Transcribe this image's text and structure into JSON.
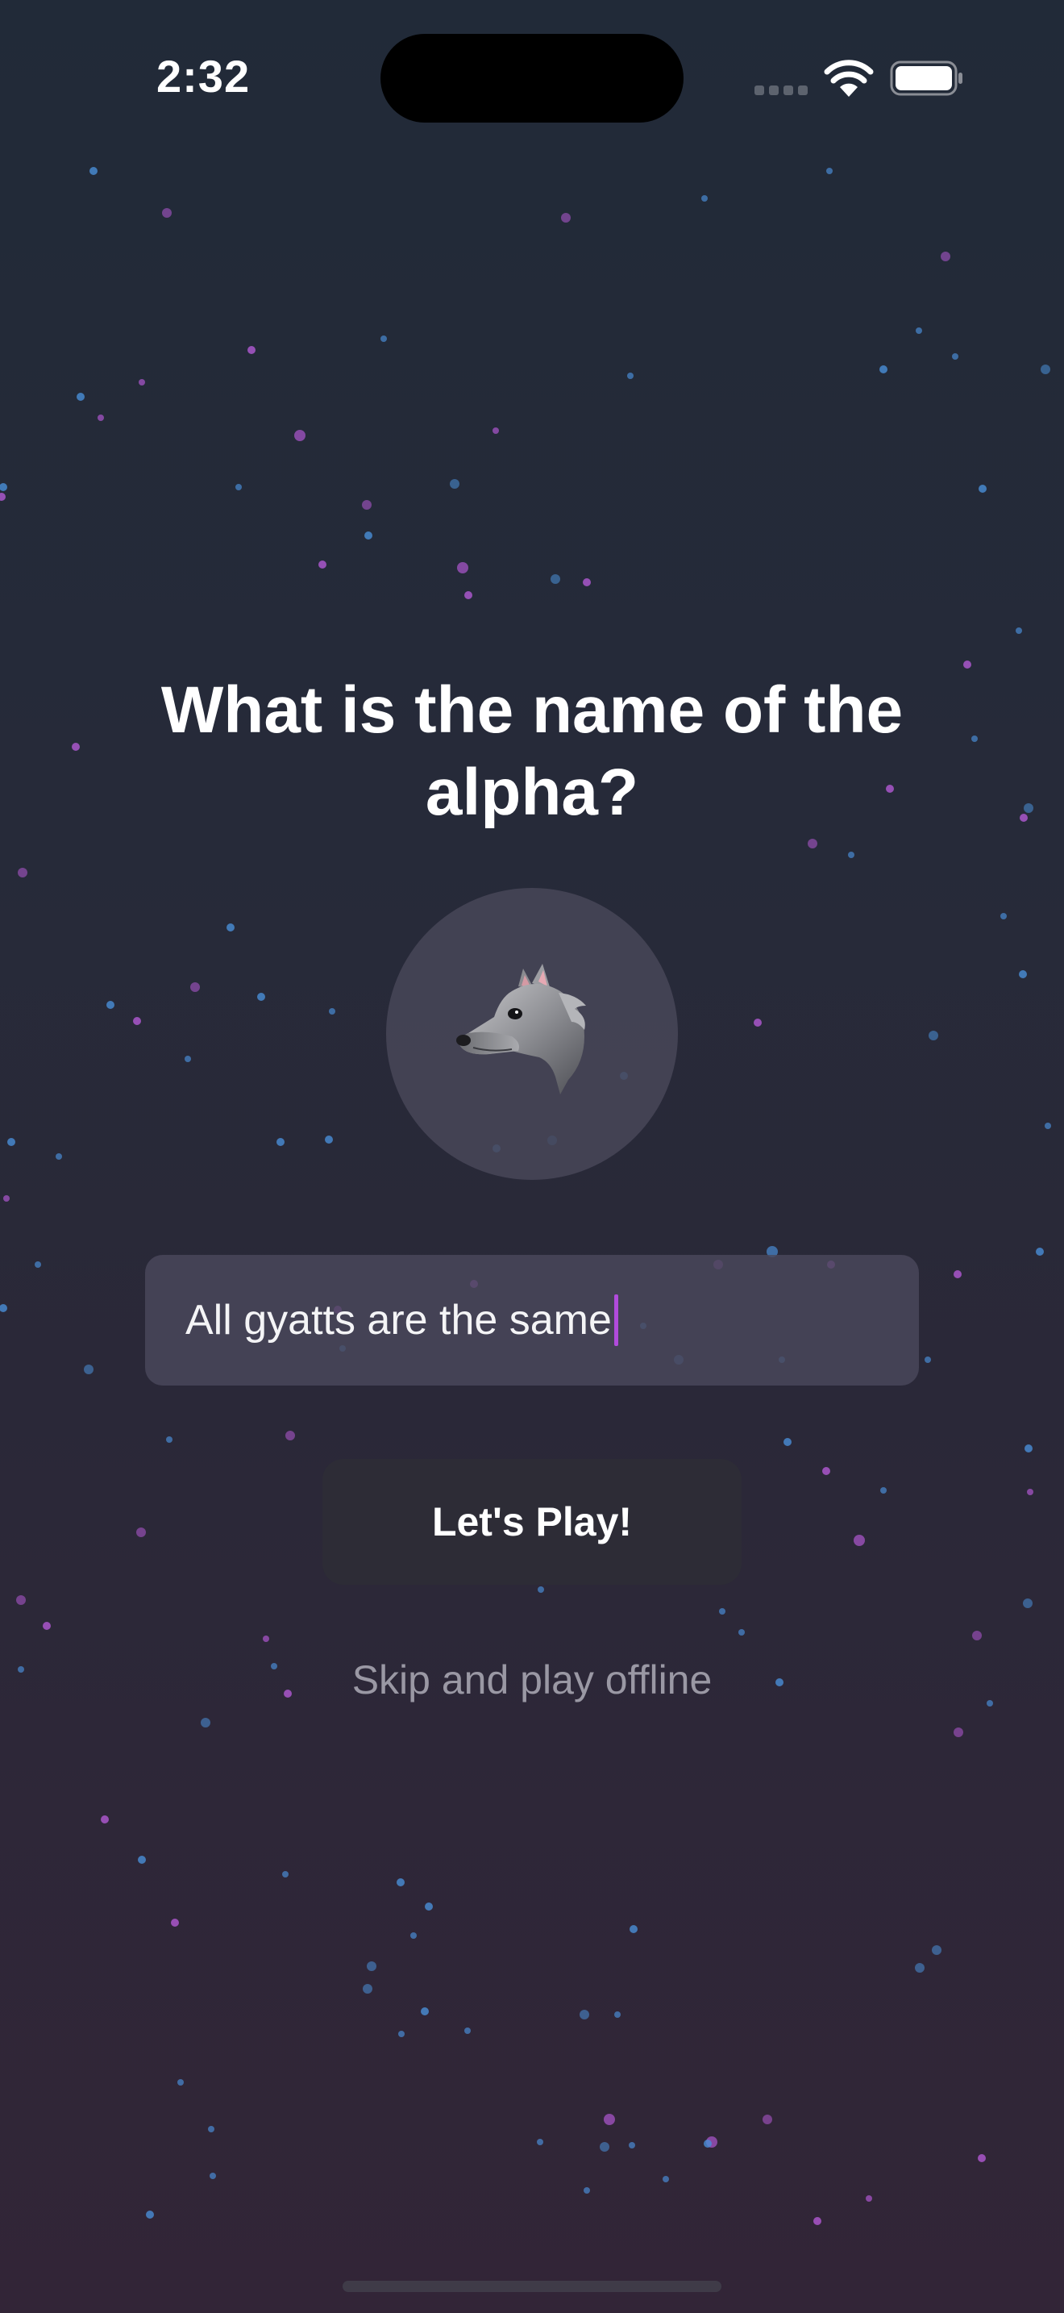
{
  "status_bar": {
    "time": "2:32"
  },
  "onboarding": {
    "title": "What is the name of the alpha?",
    "avatar_icon": "wolf-icon",
    "name_field": {
      "value": "All gyatts are the same",
      "caret_color": "#b14bdc"
    },
    "play_button_label": "Let's Play!",
    "skip_label": "Skip and play offline"
  },
  "colors": {
    "background_top": "#212a38",
    "background_bottom": "#322537",
    "star_blue": "#4a8fd9",
    "star_purple": "#b45ad6"
  }
}
